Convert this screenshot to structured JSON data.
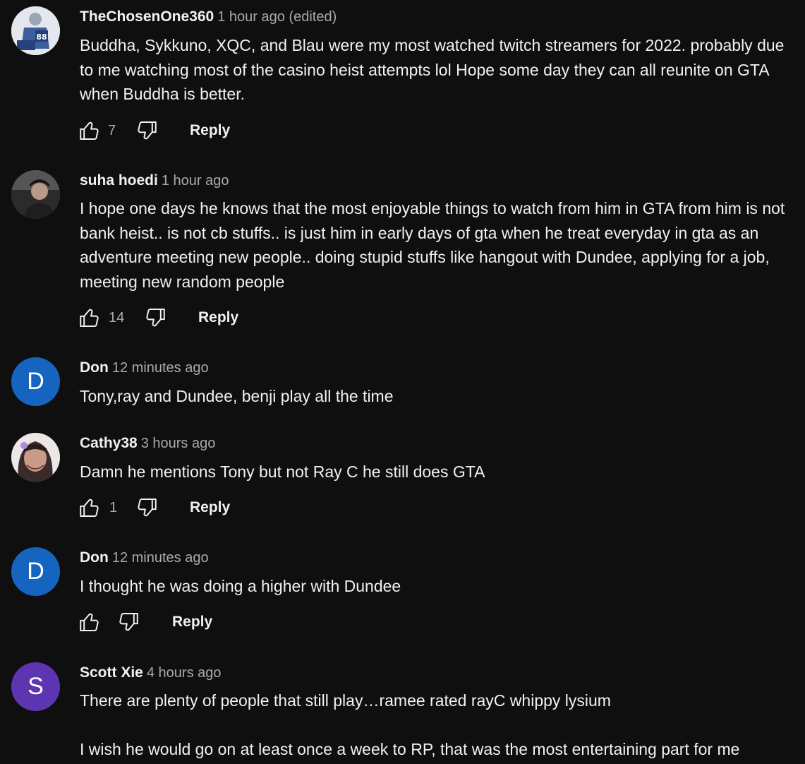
{
  "comments": [
    {
      "author": "TheChosenOne360",
      "time": "1 hour ago (edited)",
      "avatar": {
        "type": "image",
        "icon": "football-player-avatar"
      },
      "body": [
        "Buddha, Sykkuno, XQC, and Blau were my most watched twitch streamers for 2022. probably due to me watching most of the casino heist attempts lol Hope some day they can all reunite on GTA when Buddha is better."
      ],
      "likes": "7",
      "reply_label": "Reply"
    },
    {
      "author": "suha hoedi",
      "time": "1 hour ago",
      "avatar": {
        "type": "image",
        "icon": "person-photo-avatar"
      },
      "body": [
        "I hope one days he knows that the most enjoyable things to watch from him in GTA from him is not bank heist.. is not cb stuffs.. is just him in early days of gta when he treat everyday in gta as an adventure meeting new people.. doing stupid stuffs like hangout with Dundee, applying for a job, meeting new random people"
      ],
      "likes": "14",
      "reply_label": "Reply"
    },
    {
      "author": "Don",
      "time": "12 minutes ago",
      "avatar": {
        "type": "letter",
        "letter": "D",
        "color": "#1565c0"
      },
      "body": [
        "Tony,ray and Dundee, benji play all the time"
      ]
    },
    {
      "author": "Cathy38",
      "time": "3 hours ago",
      "avatar": {
        "type": "image",
        "icon": "woman-photo-avatar"
      },
      "body": [
        "Damn he mentions Tony but not Ray C he still does GTA"
      ],
      "likes": "1",
      "reply_label": "Reply"
    },
    {
      "author": "Don",
      "time": "12 minutes ago",
      "avatar": {
        "type": "letter",
        "letter": "D",
        "color": "#1565c0"
      },
      "body": [
        "I thought he was doing a higher with Dundee"
      ],
      "likes": "",
      "reply_label": "Reply"
    },
    {
      "author": "Scott Xie",
      "time": "4 hours ago",
      "avatar": {
        "type": "letter",
        "letter": "S",
        "color": "#5e35b1"
      },
      "body": [
        "There are plenty of people that still play…ramee rated rayC whippy lysium",
        "",
        "I wish he would go on at least once a week to RP, that was the most entertaining part for me"
      ]
    }
  ],
  "icons": {
    "like": "thumbs-up-icon",
    "dislike": "thumbs-down-icon"
  },
  "colors": {
    "background": "#0f0f0f",
    "text": "#f1f1f1",
    "secondary_text": "#aaaaaa"
  }
}
